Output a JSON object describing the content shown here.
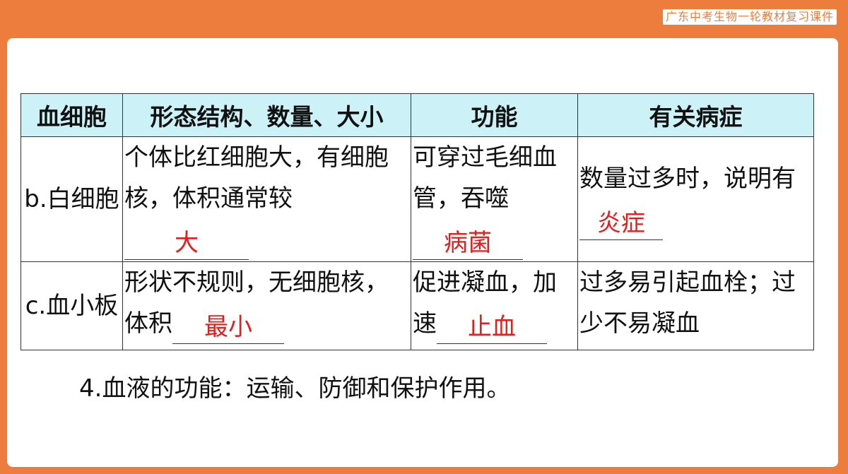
{
  "header": {
    "badge": "广东中考生物一轮教材复习课件"
  },
  "table": {
    "headers": [
      "血细胞",
      "形态结构、数量、大小",
      "功能",
      "有关病症"
    ],
    "rows": [
      {
        "name": "b.白细胞",
        "structure": "个体比红细胞大，有细胞核，体积通常较",
        "structure_answer": "大",
        "function": "可穿过毛细血管，吞噬",
        "function_answer": "病菌",
        "disease_prefix": "数量过多时，说明有",
        "disease_answer": "炎症"
      },
      {
        "name": "c.血小板",
        "structure": "形状不规则，无细胞核，体积",
        "structure_answer": "最小",
        "function": "促进凝血，加速",
        "function_answer": "止血",
        "disease": "过多易引起血栓；过少不易凝血"
      }
    ]
  },
  "footer": {
    "text": "4.血液的功能：运输、防御和保护作用。"
  }
}
